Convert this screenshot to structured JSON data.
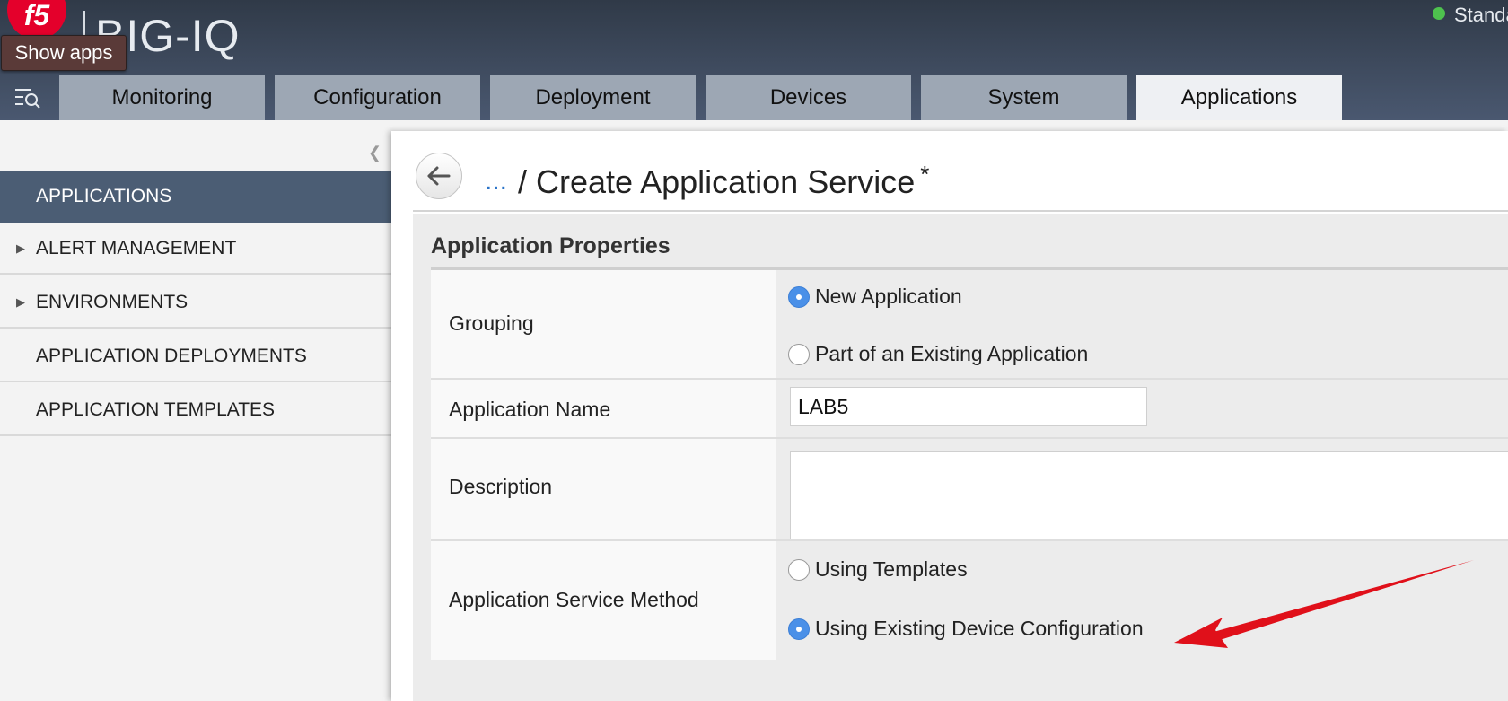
{
  "header": {
    "logo_text": "f5",
    "product_name": "BIG-IQ",
    "show_apps_tooltip": "Show apps",
    "status_text": "Standalone",
    "status_color": "#4ec24e",
    "menu_icon": "menu-search-icon"
  },
  "tabs": [
    {
      "label": "Monitoring",
      "active": false
    },
    {
      "label": "Configuration",
      "active": false
    },
    {
      "label": "Deployment",
      "active": false
    },
    {
      "label": "Devices",
      "active": false
    },
    {
      "label": "System",
      "active": false
    },
    {
      "label": "Applications",
      "active": true
    }
  ],
  "sidebar": {
    "collapse_icon": "chevron-left-icon",
    "items": [
      {
        "label": "APPLICATIONS",
        "active": true,
        "expandable": false
      },
      {
        "label": "ALERT MANAGEMENT",
        "active": false,
        "expandable": true
      },
      {
        "label": "ENVIRONMENTS",
        "active": false,
        "expandable": true
      },
      {
        "label": "APPLICATION DEPLOYMENTS",
        "active": false,
        "expandable": false
      },
      {
        "label": "APPLICATION TEMPLATES",
        "active": false,
        "expandable": false
      }
    ]
  },
  "page": {
    "back_icon": "back-arrow-icon",
    "breadcrumb_link": "...",
    "title": "/ Create Application Service",
    "required_mark": "*"
  },
  "form": {
    "section_title": "Application Properties",
    "grouping": {
      "label": "Grouping",
      "options": [
        {
          "label": "New Application",
          "checked": true
        },
        {
          "label": "Part of an Existing Application",
          "checked": false
        }
      ]
    },
    "app_name": {
      "label": "Application Name",
      "value": "LAB5"
    },
    "description": {
      "label": "Description",
      "value": ""
    },
    "service_method": {
      "label": "Application Service Method",
      "options": [
        {
          "label": "Using Templates",
          "checked": false
        },
        {
          "label": "Using Existing Device Configuration",
          "checked": true
        }
      ]
    }
  },
  "colors": {
    "accent": "#4a90e8",
    "header": "#3a4658",
    "active_nav": "#4b5d74",
    "annotation_arrow": "#e0101a"
  }
}
